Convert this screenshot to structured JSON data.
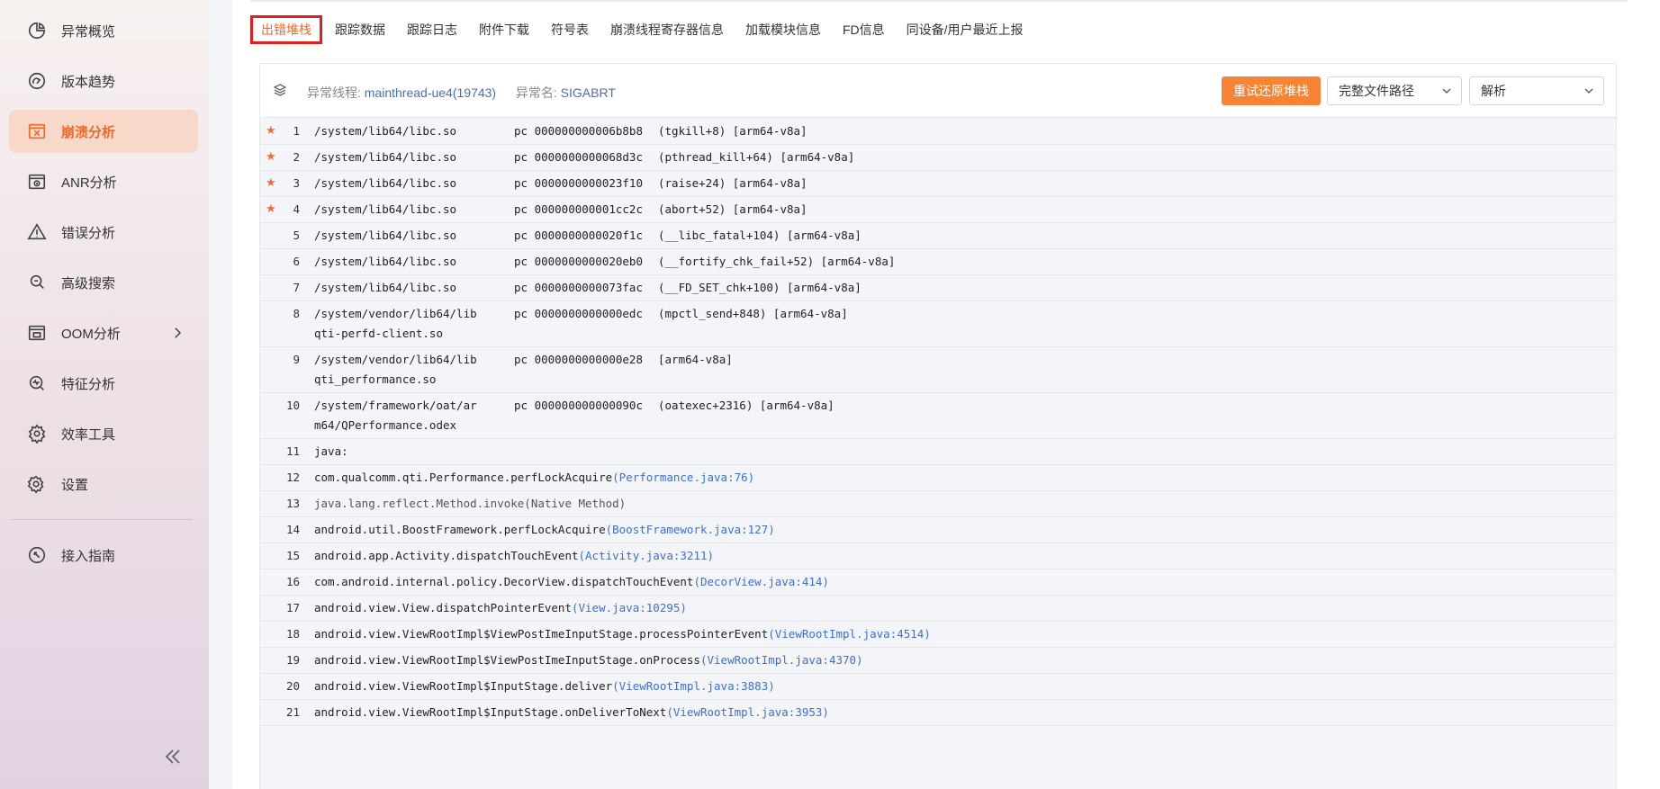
{
  "sidebar": {
    "items": [
      {
        "label": "异常概览",
        "icon": "pie-chart-icon"
      },
      {
        "label": "版本趋势",
        "icon": "gauge-icon"
      },
      {
        "label": "崩溃分析",
        "icon": "crash-window-icon"
      },
      {
        "label": "ANR分析",
        "icon": "anr-window-icon"
      },
      {
        "label": "错误分析",
        "icon": "warning-icon"
      },
      {
        "label": "高级搜索",
        "icon": "search-doc-icon"
      },
      {
        "label": "OOM分析",
        "icon": "memory-icon"
      },
      {
        "label": "特征分析",
        "icon": "feature-search-icon"
      },
      {
        "label": "效率工具",
        "icon": "gear-icon"
      },
      {
        "label": "设置",
        "icon": "settings-icon"
      },
      {
        "label": "接入指南",
        "icon": "compass-icon"
      }
    ],
    "active_index": 2,
    "active_color": "#ee6a2c"
  },
  "tabs": [
    "出错堆栈",
    "跟踪数据",
    "跟踪日志",
    "附件下载",
    "符号表",
    "崩溃线程寄存器信息",
    "加载模块信息",
    "FD信息",
    "同设备/用户最近上报"
  ],
  "panel": {
    "thread_label": "异常线程:",
    "thread_value": "mainthread-ue4(19743)",
    "name_label": "异常名:",
    "name_value": "SIGABRT",
    "retry_button": "重试还原堆栈",
    "path_select": "完整文件路径",
    "mode_select": "解析"
  },
  "native_frames": [
    {
      "num": "1",
      "star": true,
      "lib": "/system/lib64/libc.so",
      "pc": "pc 000000000006b8b8",
      "fn": "(tgkill+8) [arm64-v8a]"
    },
    {
      "num": "2",
      "star": true,
      "lib": "/system/lib64/libc.so",
      "pc": "pc 0000000000068d3c",
      "fn": "(pthread_kill+64) [arm64-v8a]"
    },
    {
      "num": "3",
      "star": true,
      "lib": "/system/lib64/libc.so",
      "pc": "pc 0000000000023f10",
      "fn": "(raise+24) [arm64-v8a]"
    },
    {
      "num": "4",
      "star": true,
      "lib": "/system/lib64/libc.so",
      "pc": "pc 000000000001cc2c",
      "fn": "(abort+52) [arm64-v8a]"
    },
    {
      "num": "5",
      "star": false,
      "lib": "/system/lib64/libc.so",
      "pc": "pc 0000000000020f1c",
      "fn": "(__libc_fatal+104) [arm64-v8a]"
    },
    {
      "num": "6",
      "star": false,
      "lib": "/system/lib64/libc.so",
      "pc": "pc 0000000000020eb0",
      "fn": "(__fortify_chk_fail+52) [arm64-v8a]"
    },
    {
      "num": "7",
      "star": false,
      "lib": "/system/lib64/libc.so",
      "pc": "pc 0000000000073fac",
      "fn": "(__FD_SET_chk+100) [arm64-v8a]"
    },
    {
      "num": "8",
      "star": false,
      "lib": "/system/vendor/lib64/libqti-perfd-client.so",
      "pc": "pc 0000000000000edc",
      "fn": "(mpctl_send+848) [arm64-v8a]"
    },
    {
      "num": "9",
      "star": false,
      "lib": "/system/vendor/lib64/libqti_performance.so",
      "pc": "pc 0000000000000e28",
      "fn": "[arm64-v8a]"
    },
    {
      "num": "10",
      "star": false,
      "lib": "/system/framework/oat/arm64/QPerformance.odex",
      "pc": "pc 000000000000090c",
      "fn": "(oatexec+2316) [arm64-v8a]"
    }
  ],
  "java_frames": [
    {
      "num": "11",
      "method": "java:",
      "loc": "",
      "native": false
    },
    {
      "num": "12",
      "method": "com.qualcomm.qti.Performance.perfLockAcquire",
      "loc": "(Performance.java:76)",
      "native": false
    },
    {
      "num": "13",
      "method": "java.lang.reflect.Method.invoke(Native Method)",
      "loc": "",
      "native": true
    },
    {
      "num": "14",
      "method": "android.util.BoostFramework.perfLockAcquire",
      "loc": "(BoostFramework.java:127)",
      "native": false
    },
    {
      "num": "15",
      "method": "android.app.Activity.dispatchTouchEvent",
      "loc": "(Activity.java:3211)",
      "native": false
    },
    {
      "num": "16",
      "method": "com.android.internal.policy.DecorView.dispatchTouchEvent",
      "loc": "(DecorView.java:414)",
      "native": false
    },
    {
      "num": "17",
      "method": "android.view.View.dispatchPointerEvent",
      "loc": "(View.java:10295)",
      "native": false
    },
    {
      "num": "18",
      "method": "android.view.ViewRootImpl$ViewPostImeInputStage.processPointerEvent",
      "loc": "(ViewRootImpl.java:4514)",
      "native": false
    },
    {
      "num": "19",
      "method": "android.view.ViewRootImpl$ViewPostImeInputStage.onProcess",
      "loc": "(ViewRootImpl.java:4370)",
      "native": false
    },
    {
      "num": "20",
      "method": "android.view.ViewRootImpl$InputStage.deliver",
      "loc": "(ViewRootImpl.java:3883)",
      "native": false
    },
    {
      "num": "21",
      "method": "android.view.ViewRootImpl$InputStage.onDeliverToNext",
      "loc": "(ViewRootImpl.java:3953)",
      "native": false
    }
  ],
  "colors": {
    "accent": "#ee6a2c",
    "button": "#f78434",
    "link": "#3d6fd6",
    "highlight_border": "#e02020"
  }
}
